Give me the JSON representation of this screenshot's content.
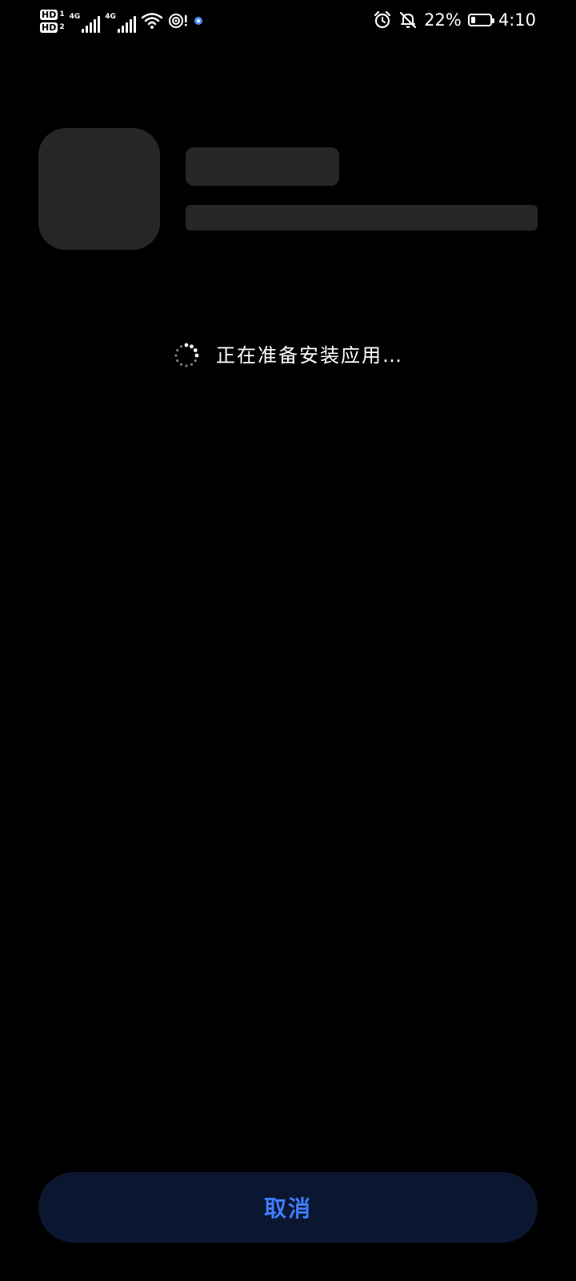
{
  "status_bar": {
    "sim1_badge": "HD",
    "sim1_index": "1",
    "sim2_badge": "HD",
    "sim2_index": "2",
    "sim1_network": "4G",
    "sim2_network": "4G",
    "battery_percent": "22%",
    "battery_level": 0.22,
    "time": "4:10",
    "icons": [
      "signal-icon",
      "wifi-icon",
      "hotspot-icon",
      "notification-dot-icon",
      "alarm-icon",
      "bell-muted-icon",
      "battery-icon"
    ]
  },
  "installer": {
    "loading_text": "正在准备安装应用…",
    "cancel_label": "取消"
  },
  "colors": {
    "background": "#000000",
    "placeholder": "#262626",
    "button_bg": "#0b1730",
    "accent": "#3f7cff"
  }
}
